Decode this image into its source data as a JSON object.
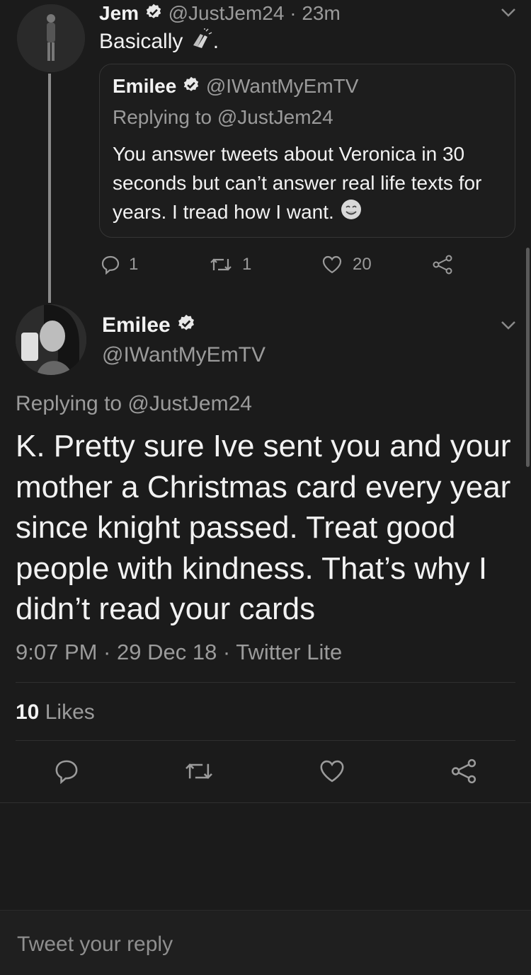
{
  "parent_tweet": {
    "name": "Jem",
    "handle": "@JustJem24",
    "time": "· 23m",
    "text": "Basically",
    "text_suffix": ".",
    "quoted": {
      "name": "Emilee",
      "handle": "@IWantMyEmTV",
      "replying_to": "Replying to @JustJem24",
      "text": "You answer tweets about Veronica in 30 seconds but can’t answer real life texts for years. I tread how I want."
    },
    "actions": {
      "replies": "1",
      "retweets": "1",
      "likes": "20"
    }
  },
  "main_tweet": {
    "name": "Emilee",
    "handle": "@IWantMyEmTV",
    "replying_to": "Replying to @JustJem24",
    "text": "K. Pretty sure Ive sent you and your mother a Christmas card every year since knight passed. Treat good people with kindness. That’s why I didn’t read your cards",
    "meta": "9:07 PM · 29 Dec 18 · Twitter Lite",
    "likes_count": "10",
    "likes_label": "Likes"
  },
  "reply_box": {
    "placeholder": "Tweet your reply"
  },
  "icons": {
    "verified": "verified-badge-icon",
    "chevron": "chevron-down-icon",
    "reply": "reply-icon",
    "retweet": "retweet-icon",
    "like": "heart-icon",
    "share": "share-icon",
    "clap": "clapping-hands-emoji",
    "smile": "smiling-face-emoji"
  },
  "colors": {
    "background": "#1b1b1b",
    "text": "#f2f2f2",
    "muted": "#9b9b9b"
  }
}
